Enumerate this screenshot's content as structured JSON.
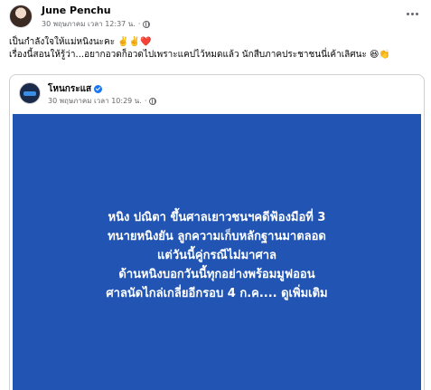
{
  "post": {
    "author": "June Penchu",
    "timestamp": "30 พฤษภาคม เวลา 12:37 น.",
    "separator": "·",
    "privacy_icon": "globe-icon",
    "menu_icon": "more-icon",
    "text_lines": [
      "เป็นกำลังใจให้แม่หนิงนะคะ ✌️✌️❤️",
      "เรื่องนี้สอนให้รู้ว่า...อยากอวดก็อวดไปเพราะแคปไว้หมดแล้ว นักสืบภาคประชาชนนี่เค้าเลิศนะ 😆👏"
    ]
  },
  "shared_post": {
    "page_name": "โหนกระแส",
    "verified_icon": "verified-badge-icon",
    "timestamp": "30 พฤษภาคม เวลา 10:29 น.",
    "separator": "·",
    "privacy_icon": "globe-icon",
    "image_bg_color": "#2255b3",
    "headline_lines": [
      "หนิง ปณิตา ขึ้นศาลเยาวชนฯคดีฟ้องมือที่ 3",
      "ทนายหนิงยัน ลูกความเก็บหลักฐานมาตลอด",
      "แต่วันนี้คู่กรณีไม่มาศาล",
      "ด้านหนิงบอกวันนี้ทุกอย่างพร้อมมูฟออน",
      "ศาลนัดไกล่เกลี่ยอีกรอบ 4 ก.ค.... ดูเพิ่มเติม"
    ]
  }
}
